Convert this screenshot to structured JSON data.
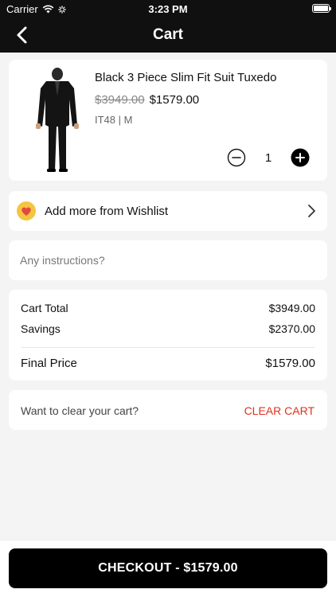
{
  "status_bar": {
    "carrier": "Carrier",
    "time": "3:23 PM"
  },
  "nav": {
    "title": "Cart",
    "back_icon": "chevron-left-icon"
  },
  "cart_item": {
    "name": "Black 3 Piece Slim Fit Suit Tuxedo",
    "original_price": "$3949.00",
    "price": "$1579.00",
    "variant": "IT48 | M",
    "quantity": "1"
  },
  "wishlist": {
    "label": "Add more from Wishlist",
    "icon": "heart-icon"
  },
  "instructions": {
    "placeholder": "Any instructions?",
    "value": ""
  },
  "summary": {
    "cart_total_label": "Cart Total",
    "cart_total_value": "$3949.00",
    "savings_label": "Savings",
    "savings_value": "$2370.00",
    "final_label": "Final Price",
    "final_value": "$1579.00"
  },
  "clear_cart": {
    "prompt": "Want to clear your cart?",
    "action": "CLEAR CART"
  },
  "checkout": {
    "label": "CHECKOUT - $1579.00"
  },
  "colors": {
    "bar": "#101010",
    "accent_red": "#e0301e",
    "background": "#f4f4f4",
    "heart_badge": "#f5c542"
  }
}
